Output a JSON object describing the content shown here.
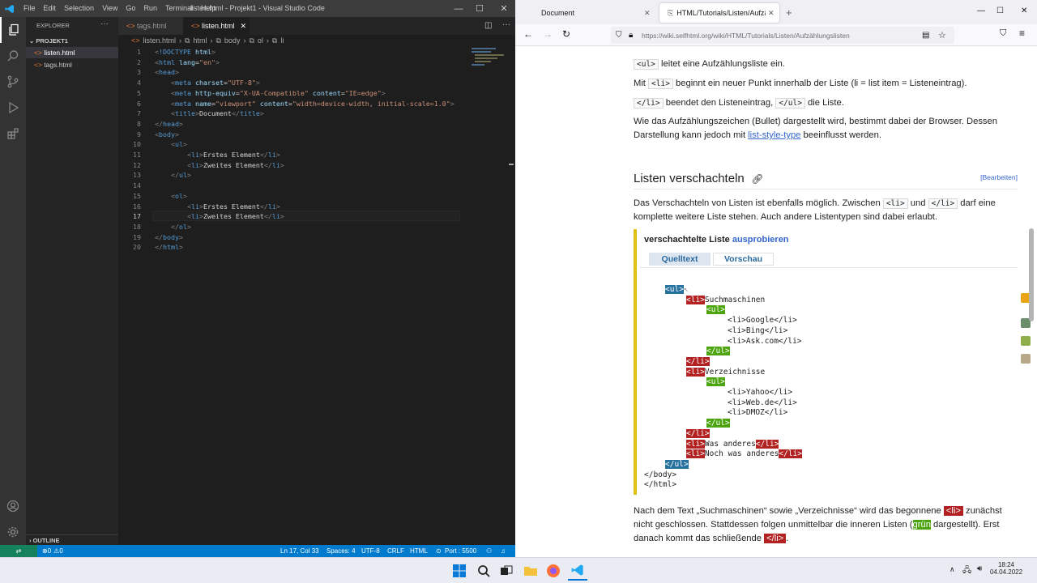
{
  "vscode": {
    "menu": [
      "File",
      "Edit",
      "Selection",
      "View",
      "Go",
      "Run",
      "Terminal",
      "Help"
    ],
    "title": "listen.html - Projekt1 - Visual Studio Code",
    "explorer_title": "EXPLORER",
    "explorer_more": "···",
    "project": "PROJEKT1",
    "files": [
      "listen.html",
      "tags.html"
    ],
    "outline": "OUTLINE",
    "tabs": [
      "tags.html",
      "listen.html"
    ],
    "breadcrumb": [
      "listen.html",
      "html",
      "body",
      "ol",
      "li"
    ],
    "line_numbers": [
      "1",
      "2",
      "3",
      "4",
      "5",
      "6",
      "7",
      "8",
      "9",
      "10",
      "11",
      "12",
      "13",
      "14",
      "15",
      "16",
      "17",
      "18",
      "19",
      "20"
    ],
    "status": {
      "errors": "0",
      "warnings": "0",
      "position": "Ln 17, Col 33",
      "spaces": "Spaces: 4",
      "encoding": "UTF-8",
      "eol": "CRLF",
      "language": "HTML",
      "port": "Port : 5500"
    }
  },
  "browser": {
    "tabs": [
      "Document",
      "HTML/Tutorials/Listen/Aufzähl"
    ],
    "url": "https://wiki.selfhtml.org/wiki/HTML/Tutorials/Listen/Aufzählungslisten",
    "texts": {
      "p1_tag": "<ul>",
      "p1": " leitet eine Aufzählungsliste ein.",
      "p2a": "Mit ",
      "p2_tag": "<li>",
      "p2b": " beginnt ein neuer Punkt innerhalb der Liste (li = list item = Listeneintrag).",
      "p3_tag1": "</li>",
      "p3a": " beendet den Listeneintrag, ",
      "p3_tag2": "</ul>",
      "p3b": " die Liste.",
      "p4a": "Wie das Aufzählungszeichen (Bullet) dargestellt wird, bestimmt dabei der Browser. Dessen Darstellung kann jedoch mit ",
      "p4_link": "list-style-type",
      "p4b": " beeinflusst werden.",
      "heading": "Listen verschachteln",
      "edit": "[Bearbeiten]",
      "p5a": "Das Verschachteln von Listen ist ebenfalls möglich. Zwischen ",
      "p5_tag1": "<li>",
      "p5b": " und ",
      "p5_tag2": "</li>",
      "p5c": " darf eine komplette weitere Liste stehen. Auch andere Listentypen sind dabei erlaubt.",
      "example_title": "verschachtelte Liste",
      "example_try": "ausprobieren",
      "tab_source": "Quelltext",
      "tab_preview": "Vorschau",
      "p6a": "Nach dem Text „Suchmaschinen“ sowie „Verzeichnisse“ wird das begonnene ",
      "p6_tag": "<li>",
      "p6b": " zunächst nicht geschlossen. Stattdessen folgen unmittelbar die inneren Listen (",
      "p6_green": "grün",
      "p6c": " dargestellt). Erst danach kommt das schließende ",
      "p6_tag2": "</li>",
      "p6d": "."
    }
  },
  "taskbar": {
    "time": "18:24",
    "date": "04.04.2022"
  }
}
